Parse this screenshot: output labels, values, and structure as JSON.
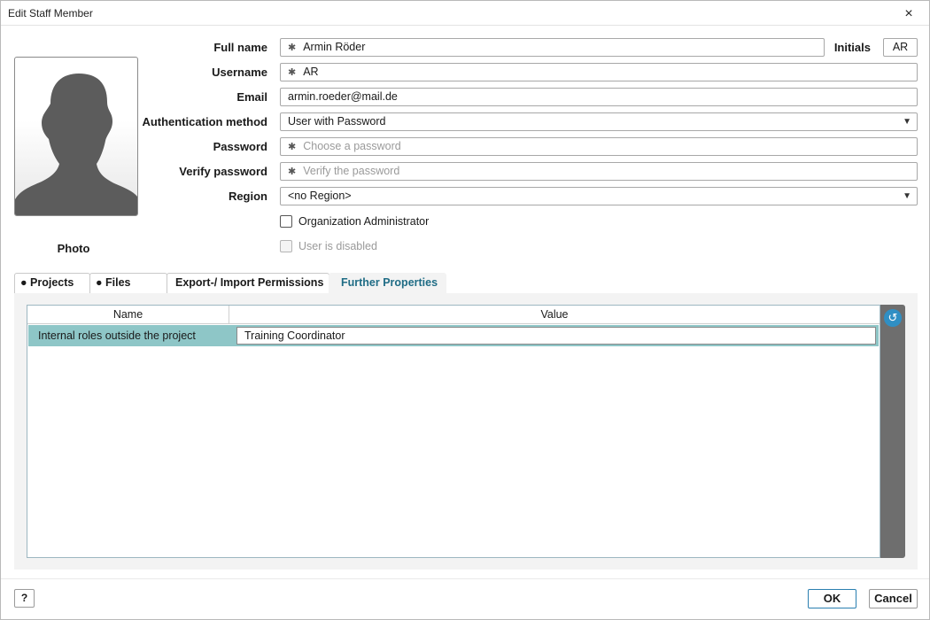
{
  "window": {
    "title": "Edit Staff Member",
    "close_icon": "×"
  },
  "photo": {
    "label": "Photo"
  },
  "form": {
    "full_name": {
      "label": "Full name",
      "value": "Armin Röder"
    },
    "initials": {
      "label": "Initials",
      "value": "AR"
    },
    "username": {
      "label": "Username",
      "value": "AR"
    },
    "email": {
      "label": "Email",
      "value": "armin.roeder@mail.de"
    },
    "auth_method": {
      "label": "Authentication method",
      "value": "User with Password"
    },
    "password": {
      "label": "Password",
      "placeholder": "Choose a password"
    },
    "verify_password": {
      "label": "Verify password",
      "placeholder": "Verify the password"
    },
    "region": {
      "label": "Region",
      "value": "<no Region>"
    },
    "org_admin": {
      "label": "Organization Administrator",
      "checked": false
    },
    "user_disabled": {
      "label": "User is disabled",
      "checked": false,
      "enabled": false
    },
    "required_marker": "✱",
    "dropdown_arrow": "▼"
  },
  "tabs": [
    {
      "label": "● Projects"
    },
    {
      "label": "● Files"
    },
    {
      "label": "Export-/ Import Permissions"
    },
    {
      "label": "Further Properties",
      "active": true
    }
  ],
  "properties_grid": {
    "headers": {
      "name": "Name",
      "value": "Value"
    },
    "rows": [
      {
        "name": "Internal roles outside the project",
        "value": "Training Coordinator"
      }
    ],
    "reset_icon": "↺"
  },
  "footer": {
    "help_label": "?",
    "ok_label": "OK",
    "cancel_label": "Cancel"
  },
  "colors": {
    "accent": "#1f6c85",
    "selected_row": "#8ec6c7",
    "reset_button": "#2f8fc4"
  }
}
